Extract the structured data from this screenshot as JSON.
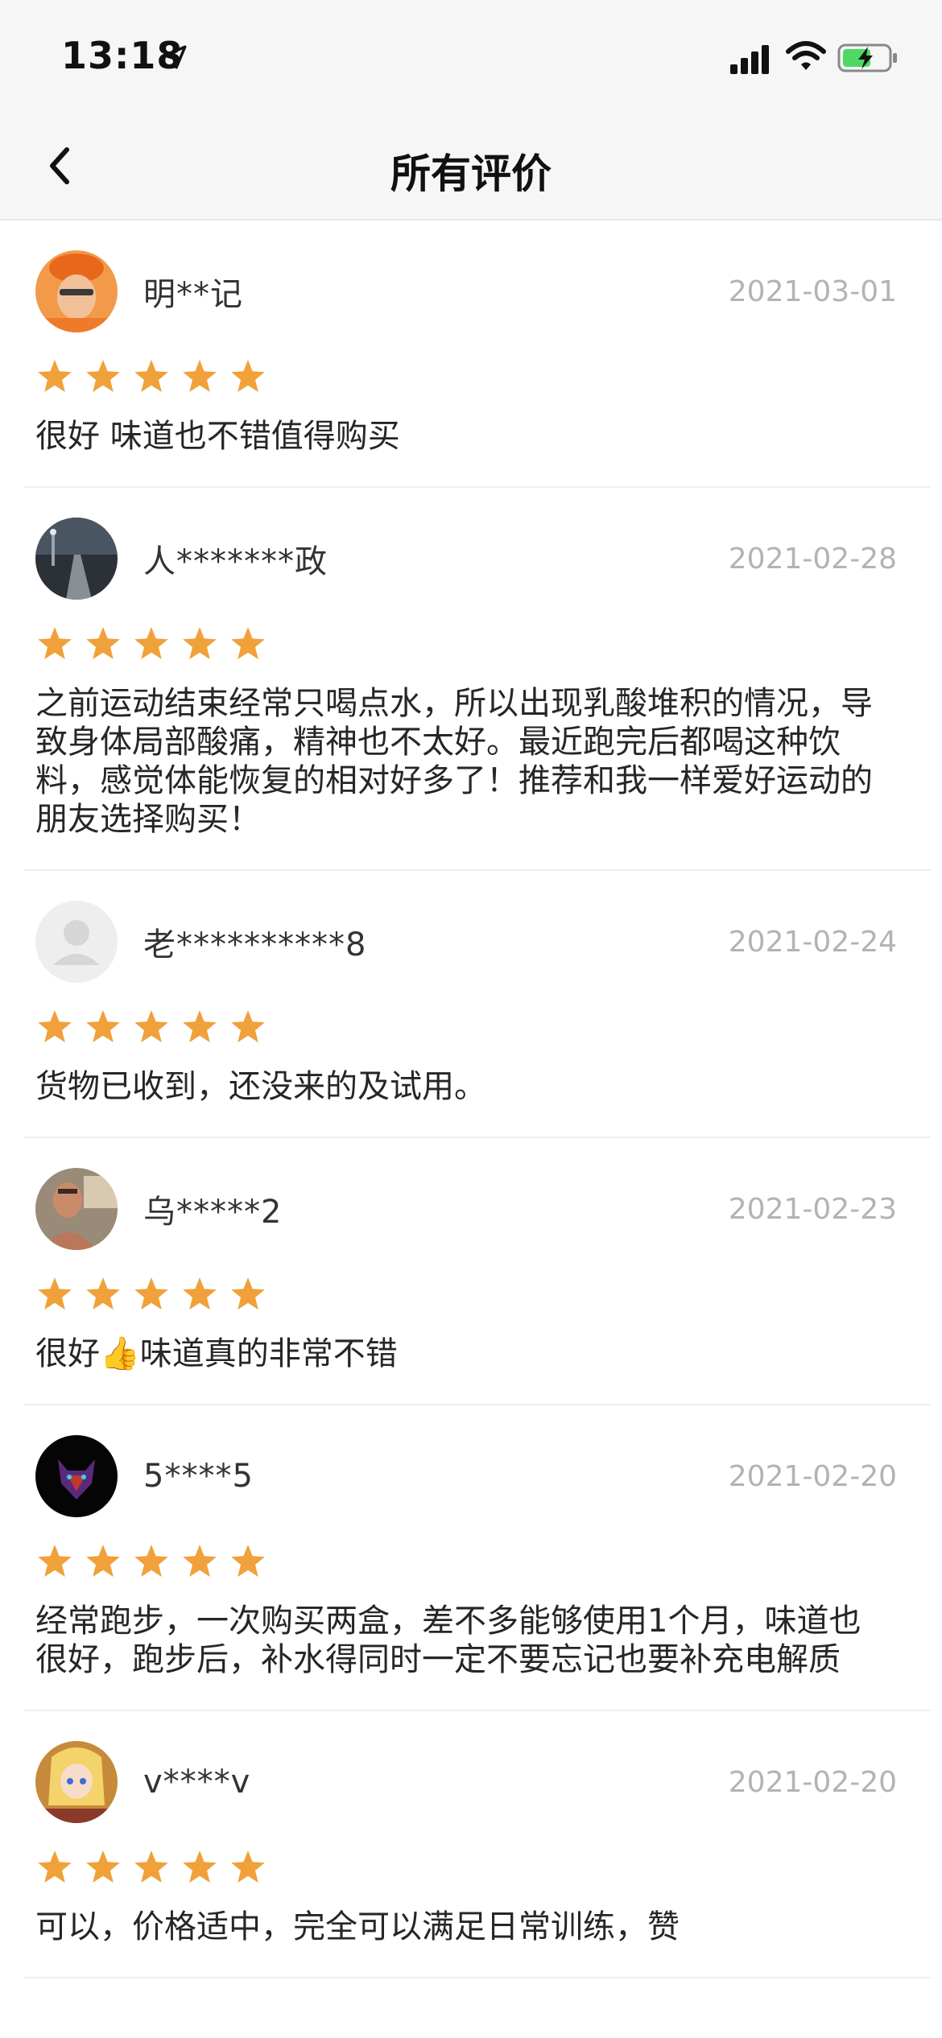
{
  "status": {
    "time": "13:18"
  },
  "nav": {
    "title": "所有评价"
  },
  "colors": {
    "star": "#f0a13a",
    "date": "#b3b3b3"
  },
  "reviews": [
    {
      "user": "明**记",
      "date": "2021-03-01",
      "rating": 5,
      "text": "很好 味道也不错值得购买",
      "avatar": "orange-hat-person"
    },
    {
      "user": "人*******政",
      "date": "2021-02-28",
      "rating": 5,
      "text": "之前运动结束经常只喝点水，所以出现乳酸堆积的情况，导致身体局部酸痛，精神也不太好。最近跑完后都喝这种饮料，感觉体能恢复的相对好多了！推荐和我一样爱好运动的朋友选择购买！",
      "avatar": "night-road"
    },
    {
      "user": "老**********8",
      "date": "2021-02-24",
      "rating": 5,
      "text": "货物已收到，还没来的及试用。",
      "avatar": "default-person"
    },
    {
      "user": "乌*****2",
      "date": "2021-02-23",
      "rating": 5,
      "text": "很好👍味道真的非常不错",
      "avatar": "boxer"
    },
    {
      "user": "5****5",
      "date": "2021-02-20",
      "rating": 5,
      "text": "经常跑步，一次购买两盒，差不多能够使用1个月，味道也很好，跑步后，补水得同时一定不要忘记也要补充电解质",
      "avatar": "wolf"
    },
    {
      "user": "v****v",
      "date": "2021-02-20",
      "rating": 5,
      "text": "可以，价格适中，完全可以满足日常训练，赞",
      "avatar": "anime-girl"
    }
  ]
}
